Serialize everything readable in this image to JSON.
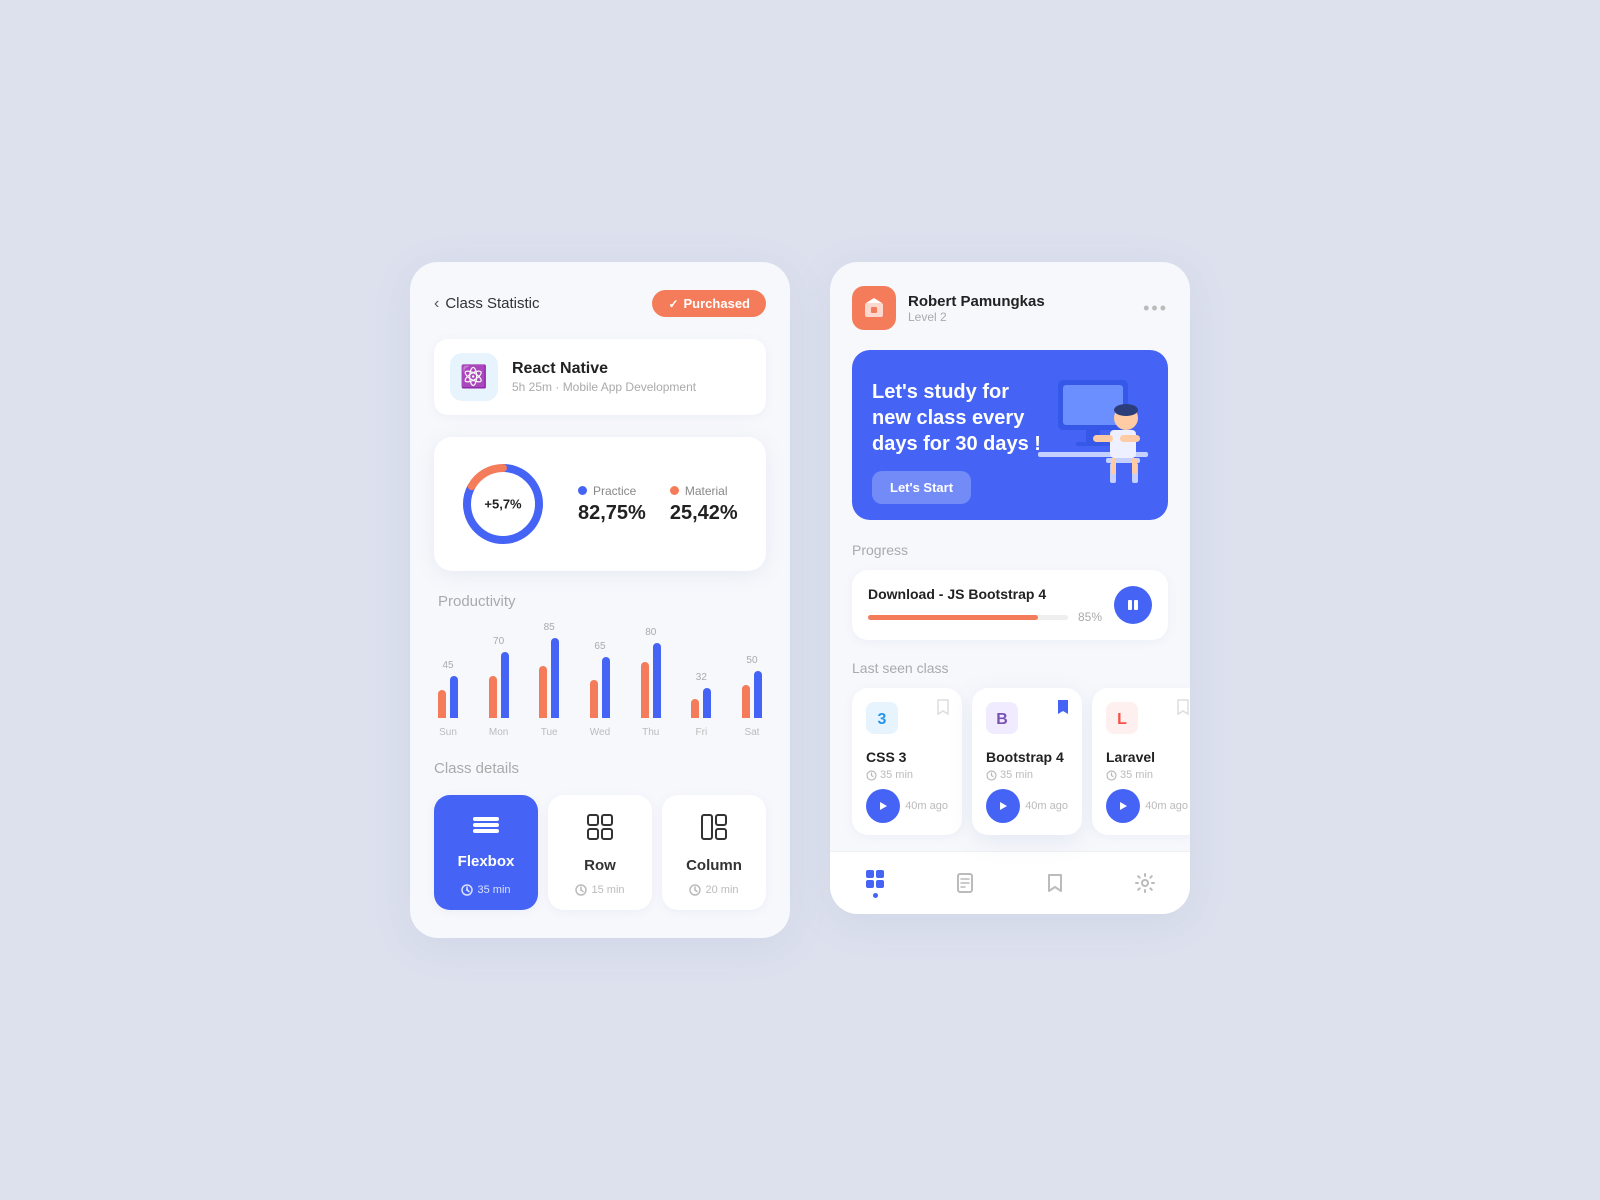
{
  "left": {
    "header": {
      "back_label": "Class Statistic",
      "purchased_label": "Purchased"
    },
    "course": {
      "title": "React Native",
      "subtitle": "5h 25m · Mobile App Development",
      "icon": "⚛️"
    },
    "stats": {
      "center_label": "+5,7%",
      "practice_label": "Practice",
      "practice_value": "82,75%",
      "material_label": "Material",
      "material_value": "25,42%"
    },
    "productivity": {
      "title": "Productivity",
      "days": [
        "Sun",
        "Mon",
        "Tue",
        "Wed",
        "Thu",
        "Fri",
        "Sat"
      ],
      "blue_vals": [
        45,
        70,
        85,
        65,
        80,
        32,
        50
      ],
      "red_vals": [
        30,
        45,
        55,
        40,
        60,
        20,
        35
      ]
    },
    "class_details": {
      "title": "Class details",
      "items": [
        {
          "icon": "☰",
          "name": "Flexbox",
          "time": "35 min",
          "active": true
        },
        {
          "icon": "⊞",
          "name": "Row",
          "time": "15 min",
          "active": false
        },
        {
          "icon": "⊟",
          "name": "Column",
          "time": "20 min",
          "active": false
        }
      ]
    }
  },
  "right": {
    "profile": {
      "name": "Robert Pamungkas",
      "level": "Level 2",
      "avatar_icon": "📦"
    },
    "banner": {
      "text": "Let's study for new class every days for 30 days !",
      "button_label": "Let's Start"
    },
    "progress": {
      "section_title": "Progress",
      "course_name": "Download - JS Bootstrap 4",
      "percent": 85,
      "percent_label": "85%"
    },
    "last_seen": {
      "title": "Last seen class",
      "items": [
        {
          "icon": "3",
          "icon_color": "#2496ed",
          "name": "CSS 3",
          "time": "35 min",
          "ago": "40m ago",
          "bookmarked": false
        },
        {
          "icon": "B",
          "icon_color": "#7952b3",
          "name": "Bootstrap 4",
          "time": "35 min",
          "ago": "40m ago",
          "bookmarked": true
        },
        {
          "icon": "L",
          "icon_color": "#f55247",
          "name": "Laravel",
          "time": "35 min",
          "ago": "40m ago",
          "bookmarked": false
        }
      ]
    },
    "nav": {
      "items": [
        "grid",
        "book",
        "bookmark",
        "settings"
      ]
    }
  }
}
